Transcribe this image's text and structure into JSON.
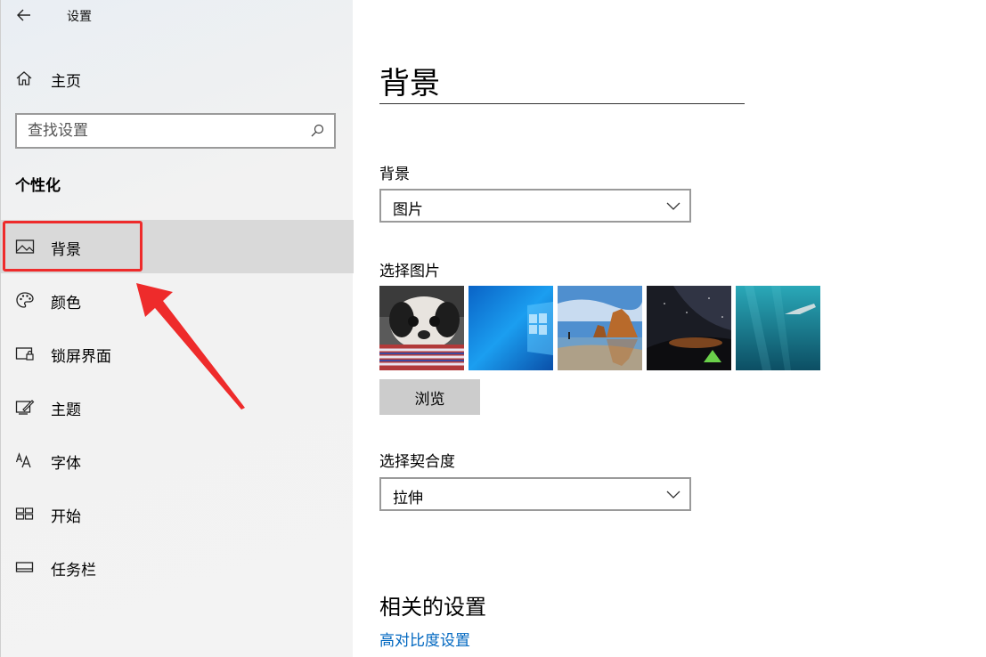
{
  "window": {
    "title": "设置"
  },
  "sidebar": {
    "home_label": "主页",
    "search_placeholder": "查找设置",
    "section_title": "个性化",
    "items": [
      {
        "label": "背景",
        "icon": "picture-icon",
        "selected": true
      },
      {
        "label": "颜色",
        "icon": "palette-icon",
        "selected": false
      },
      {
        "label": "锁屏界面",
        "icon": "lock-screen-icon",
        "selected": false
      },
      {
        "label": "主题",
        "icon": "theme-brush-icon",
        "selected": false
      },
      {
        "label": "字体",
        "icon": "font-icon",
        "selected": false
      },
      {
        "label": "开始",
        "icon": "start-grid-icon",
        "selected": false
      },
      {
        "label": "任务栏",
        "icon": "taskbar-icon",
        "selected": false
      }
    ]
  },
  "main": {
    "page_title": "背景",
    "background_label": "背景",
    "background_value": "图片",
    "choose_picture_label": "选择图片",
    "thumbnails": [
      "dog-photo",
      "windows-blue-photo",
      "beach-rocks-photo",
      "night-sky-tent-photo",
      "underwater-swimmer-photo"
    ],
    "browse_label": "浏览",
    "fit_label": "选择契合度",
    "fit_value": "拉伸",
    "related_title": "相关的设置",
    "related_link": "高对比度设置"
  },
  "colors": {
    "accent": "#0067c0",
    "highlight": "#ee2b2b",
    "selected_bg": "#d9d9d9"
  }
}
